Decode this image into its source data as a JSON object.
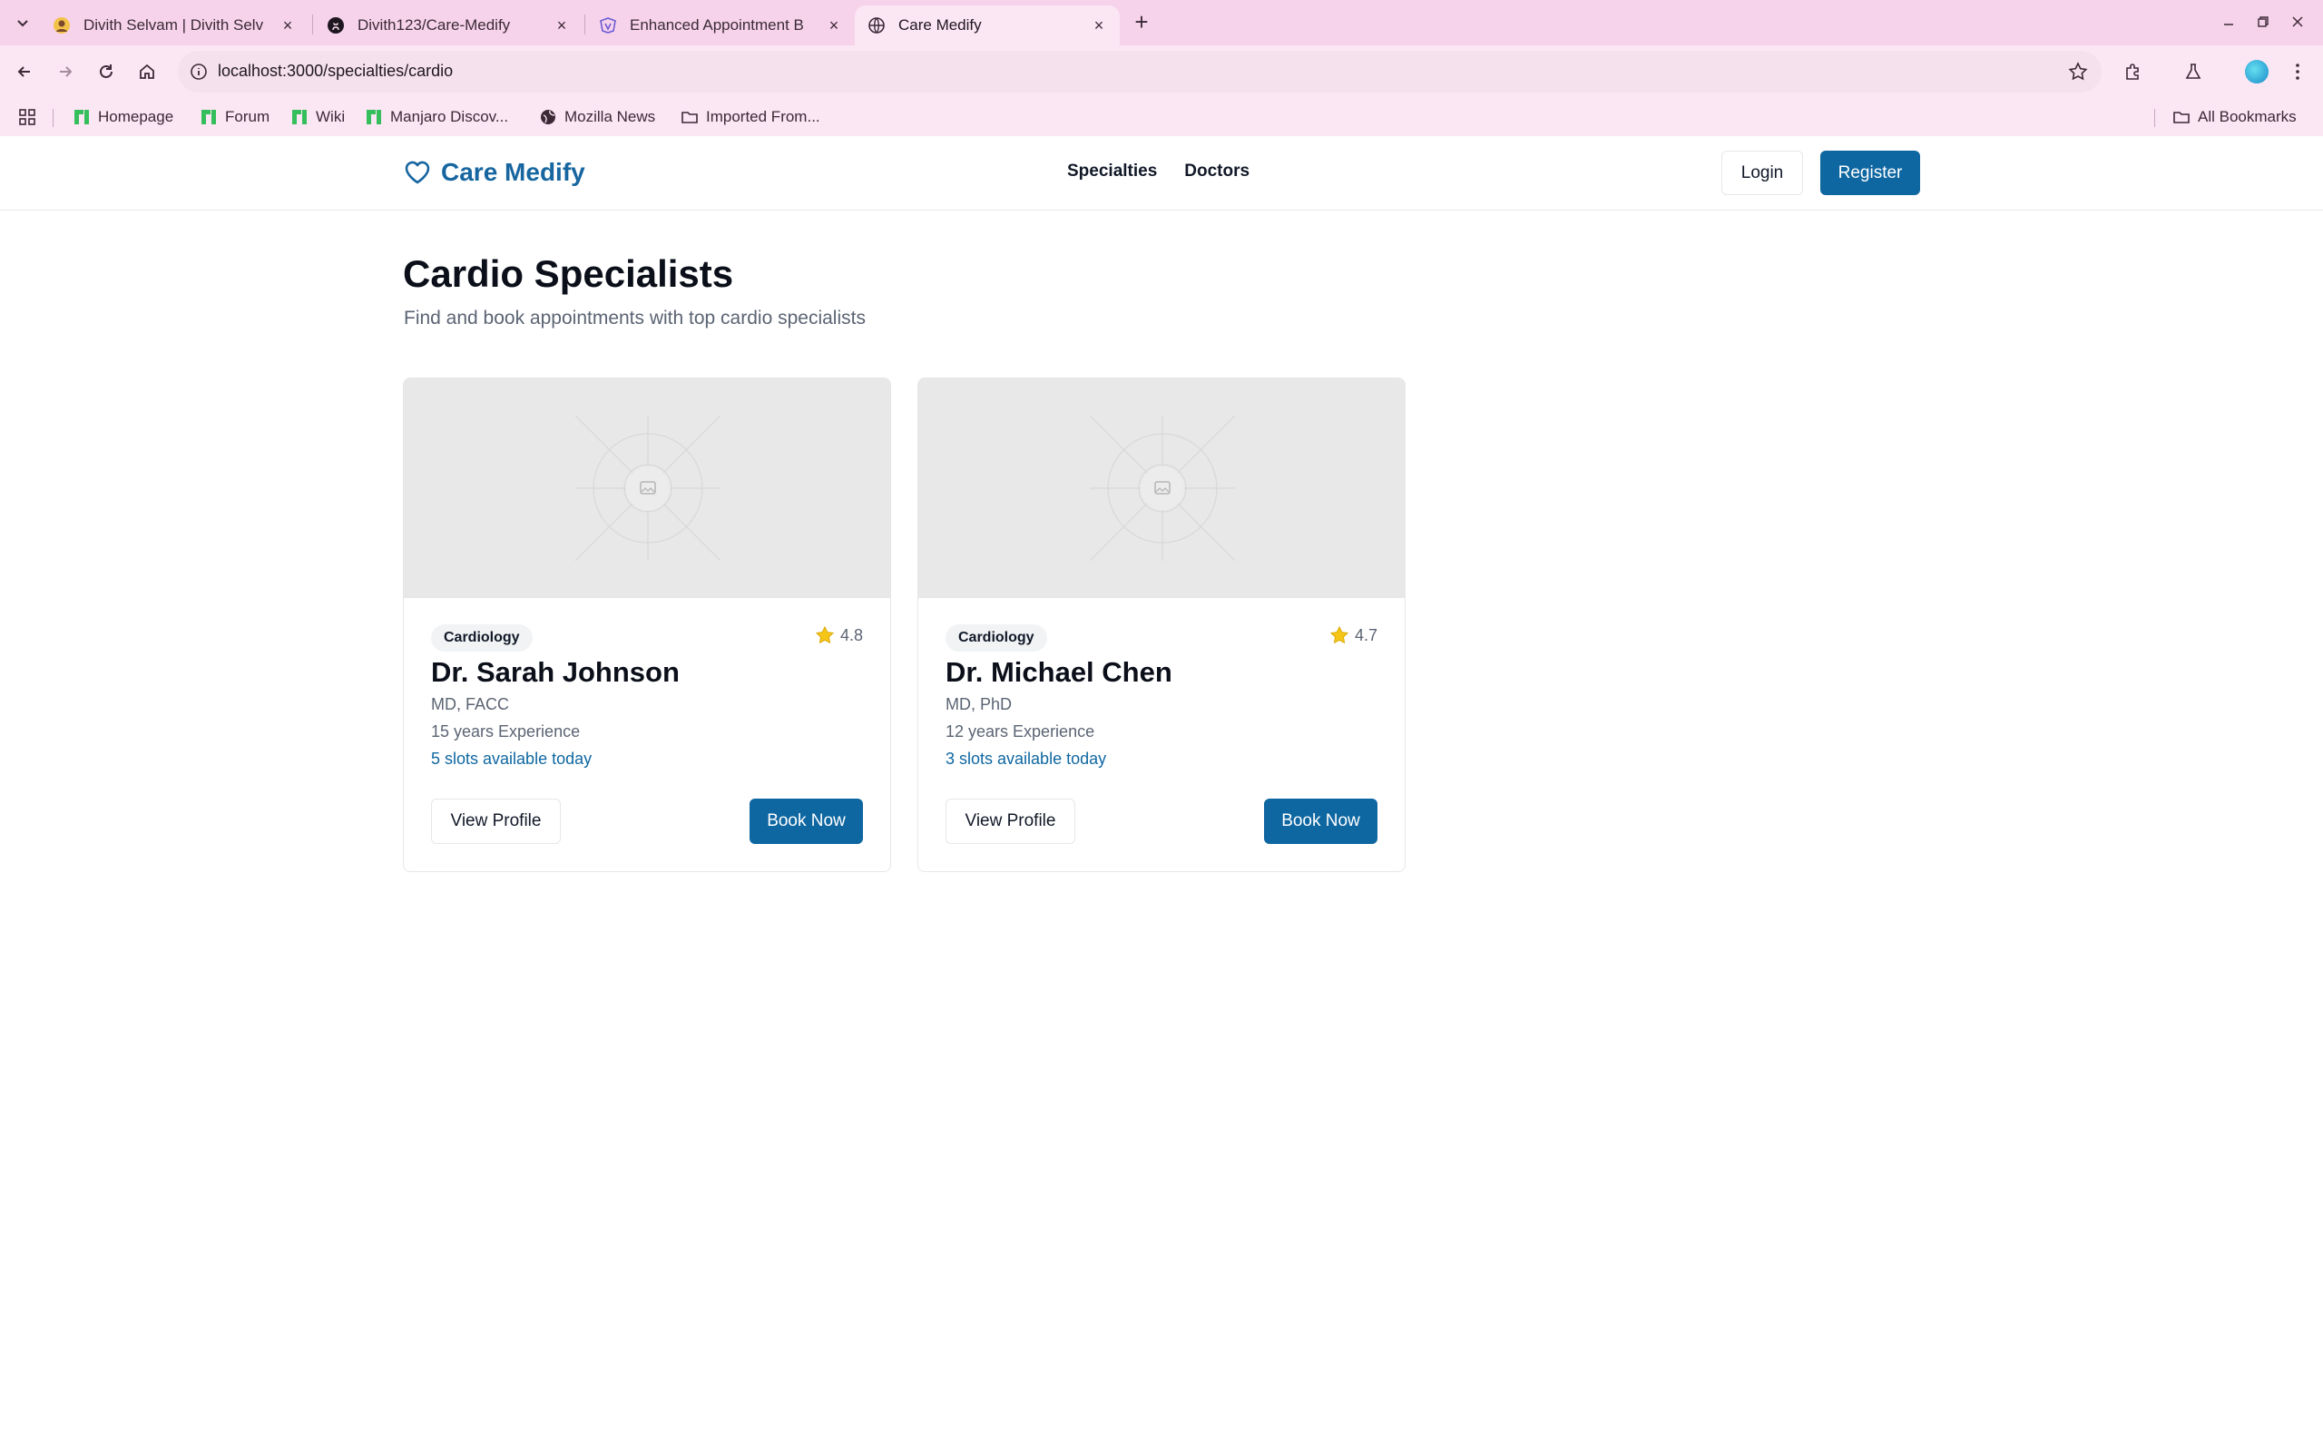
{
  "browser": {
    "tabs": [
      {
        "title": "Divith Selvam | Divith Selv",
        "active": false
      },
      {
        "title": "Divith123/Care-Medify",
        "active": false
      },
      {
        "title": "Enhanced Appointment B",
        "active": false
      },
      {
        "title": "Care Medify",
        "active": true
      }
    ],
    "url": "localhost:3000/specialties/cardio",
    "bookmarks": [
      "Homepage",
      "Forum",
      "Wiki",
      "Manjaro Discov...",
      "Mozilla News",
      "Imported From..."
    ],
    "all_bookmarks": "All Bookmarks"
  },
  "site": {
    "brand": "Care Medify",
    "nav": [
      "Specialties",
      "Doctors"
    ],
    "login": "Login",
    "register": "Register",
    "accent": "#0f67a1"
  },
  "page": {
    "title": "Cardio Specialists",
    "subtitle": "Find and book appointments with top cardio specialists"
  },
  "doctors": [
    {
      "specialty": "Cardiology",
      "rating": "4.8",
      "name": "Dr. Sarah Johnson",
      "credentials": "MD, FACC",
      "experience": "15 years Experience",
      "slots": "5 slots available today",
      "view_label": "View Profile",
      "book_label": "Book Now"
    },
    {
      "specialty": "Cardiology",
      "rating": "4.7",
      "name": "Dr. Michael Chen",
      "credentials": "MD, PhD",
      "experience": "12 years Experience",
      "slots": "3 slots available today",
      "view_label": "View Profile",
      "book_label": "Book Now"
    }
  ]
}
